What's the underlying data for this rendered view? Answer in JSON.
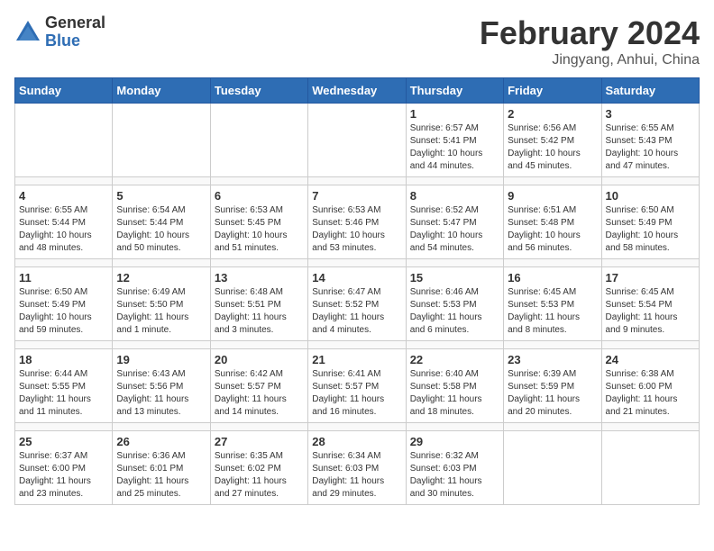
{
  "logo": {
    "general": "General",
    "blue": "Blue"
  },
  "title": "February 2024",
  "location": "Jingyang, Anhui, China",
  "weekdays": [
    "Sunday",
    "Monday",
    "Tuesday",
    "Wednesday",
    "Thursday",
    "Friday",
    "Saturday"
  ],
  "weeks": [
    [
      {
        "day": "",
        "info": ""
      },
      {
        "day": "",
        "info": ""
      },
      {
        "day": "",
        "info": ""
      },
      {
        "day": "",
        "info": ""
      },
      {
        "day": "1",
        "info": "Sunrise: 6:57 AM\nSunset: 5:41 PM\nDaylight: 10 hours\nand 44 minutes."
      },
      {
        "day": "2",
        "info": "Sunrise: 6:56 AM\nSunset: 5:42 PM\nDaylight: 10 hours\nand 45 minutes."
      },
      {
        "day": "3",
        "info": "Sunrise: 6:55 AM\nSunset: 5:43 PM\nDaylight: 10 hours\nand 47 minutes."
      }
    ],
    [
      {
        "day": "4",
        "info": "Sunrise: 6:55 AM\nSunset: 5:44 PM\nDaylight: 10 hours\nand 48 minutes."
      },
      {
        "day": "5",
        "info": "Sunrise: 6:54 AM\nSunset: 5:44 PM\nDaylight: 10 hours\nand 50 minutes."
      },
      {
        "day": "6",
        "info": "Sunrise: 6:53 AM\nSunset: 5:45 PM\nDaylight: 10 hours\nand 51 minutes."
      },
      {
        "day": "7",
        "info": "Sunrise: 6:53 AM\nSunset: 5:46 PM\nDaylight: 10 hours\nand 53 minutes."
      },
      {
        "day": "8",
        "info": "Sunrise: 6:52 AM\nSunset: 5:47 PM\nDaylight: 10 hours\nand 54 minutes."
      },
      {
        "day": "9",
        "info": "Sunrise: 6:51 AM\nSunset: 5:48 PM\nDaylight: 10 hours\nand 56 minutes."
      },
      {
        "day": "10",
        "info": "Sunrise: 6:50 AM\nSunset: 5:49 PM\nDaylight: 10 hours\nand 58 minutes."
      }
    ],
    [
      {
        "day": "11",
        "info": "Sunrise: 6:50 AM\nSunset: 5:49 PM\nDaylight: 10 hours\nand 59 minutes."
      },
      {
        "day": "12",
        "info": "Sunrise: 6:49 AM\nSunset: 5:50 PM\nDaylight: 11 hours\nand 1 minute."
      },
      {
        "day": "13",
        "info": "Sunrise: 6:48 AM\nSunset: 5:51 PM\nDaylight: 11 hours\nand 3 minutes."
      },
      {
        "day": "14",
        "info": "Sunrise: 6:47 AM\nSunset: 5:52 PM\nDaylight: 11 hours\nand 4 minutes."
      },
      {
        "day": "15",
        "info": "Sunrise: 6:46 AM\nSunset: 5:53 PM\nDaylight: 11 hours\nand 6 minutes."
      },
      {
        "day": "16",
        "info": "Sunrise: 6:45 AM\nSunset: 5:53 PM\nDaylight: 11 hours\nand 8 minutes."
      },
      {
        "day": "17",
        "info": "Sunrise: 6:45 AM\nSunset: 5:54 PM\nDaylight: 11 hours\nand 9 minutes."
      }
    ],
    [
      {
        "day": "18",
        "info": "Sunrise: 6:44 AM\nSunset: 5:55 PM\nDaylight: 11 hours\nand 11 minutes."
      },
      {
        "day": "19",
        "info": "Sunrise: 6:43 AM\nSunset: 5:56 PM\nDaylight: 11 hours\nand 13 minutes."
      },
      {
        "day": "20",
        "info": "Sunrise: 6:42 AM\nSunset: 5:57 PM\nDaylight: 11 hours\nand 14 minutes."
      },
      {
        "day": "21",
        "info": "Sunrise: 6:41 AM\nSunset: 5:57 PM\nDaylight: 11 hours\nand 16 minutes."
      },
      {
        "day": "22",
        "info": "Sunrise: 6:40 AM\nSunset: 5:58 PM\nDaylight: 11 hours\nand 18 minutes."
      },
      {
        "day": "23",
        "info": "Sunrise: 6:39 AM\nSunset: 5:59 PM\nDaylight: 11 hours\nand 20 minutes."
      },
      {
        "day": "24",
        "info": "Sunrise: 6:38 AM\nSunset: 6:00 PM\nDaylight: 11 hours\nand 21 minutes."
      }
    ],
    [
      {
        "day": "25",
        "info": "Sunrise: 6:37 AM\nSunset: 6:00 PM\nDaylight: 11 hours\nand 23 minutes."
      },
      {
        "day": "26",
        "info": "Sunrise: 6:36 AM\nSunset: 6:01 PM\nDaylight: 11 hours\nand 25 minutes."
      },
      {
        "day": "27",
        "info": "Sunrise: 6:35 AM\nSunset: 6:02 PM\nDaylight: 11 hours\nand 27 minutes."
      },
      {
        "day": "28",
        "info": "Sunrise: 6:34 AM\nSunset: 6:03 PM\nDaylight: 11 hours\nand 29 minutes."
      },
      {
        "day": "29",
        "info": "Sunrise: 6:32 AM\nSunset: 6:03 PM\nDaylight: 11 hours\nand 30 minutes."
      },
      {
        "day": "",
        "info": ""
      },
      {
        "day": "",
        "info": ""
      }
    ]
  ]
}
